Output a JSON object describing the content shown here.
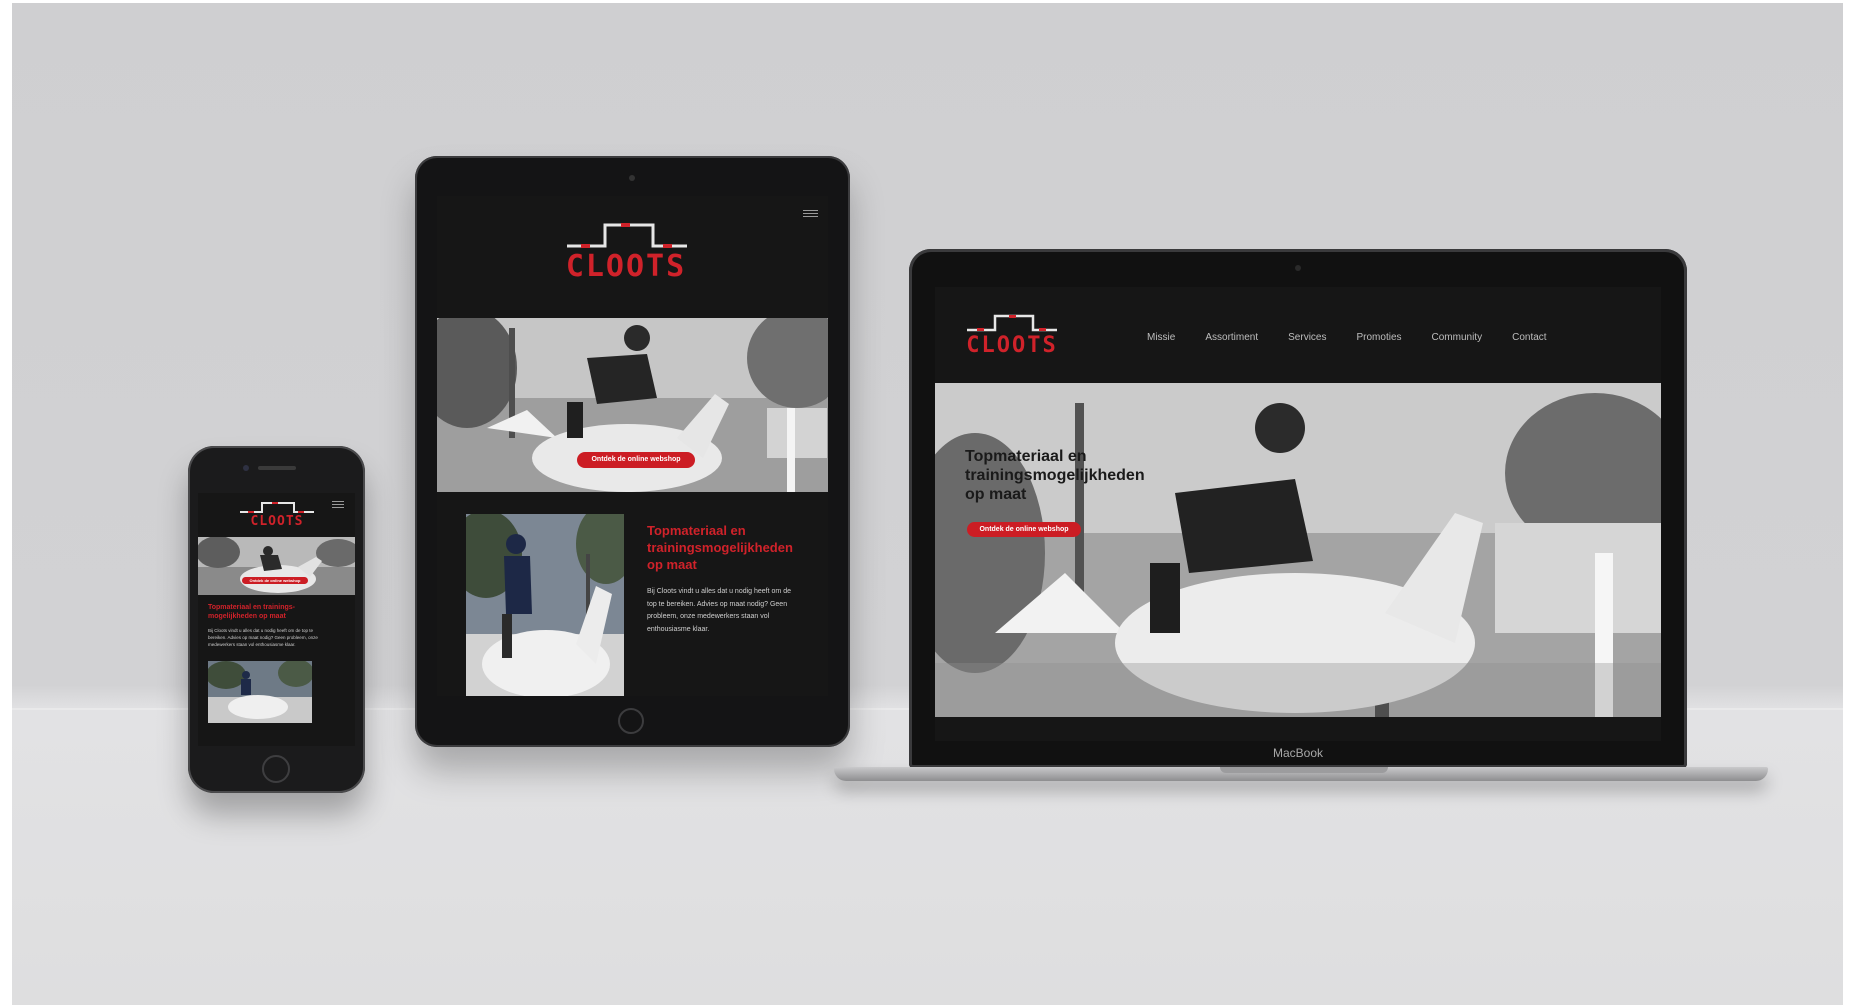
{
  "brand": {
    "name": "CLOOTS",
    "primary_color": "#d0222a",
    "background_color": "#161616"
  },
  "laptop": {
    "nav": [
      "Missie",
      "Assortiment",
      "Services",
      "Promoties",
      "Community",
      "Contact"
    ],
    "hero_title": "Topmateriaal en trainingsmogelijkheden op maat",
    "cta": "Ontdek de online webshop",
    "device_label": "MacBook"
  },
  "tablet": {
    "cta": "Ontdek de online webshop",
    "section_title": "Topmateriaal en trainingsmogelijkheden op maat",
    "section_body": "Bij Cloots vindt u alles dat u nodig heeft om de top te bereiken. Advies op maat nodig? Geen probleem, onze medewerkers staan vol enthousiasme klaar."
  },
  "phone": {
    "cta": "Ontdek de online webshop",
    "section_title": "Topmateriaal en trainings-mogelijkheden op maat",
    "section_body": "Bij Cloots vindt u alles dat u nodig heeft om de top te bereiken. Advies op maat nodig? Geen probleem, onze medewerkers staan vol enthousiasme klaar."
  }
}
